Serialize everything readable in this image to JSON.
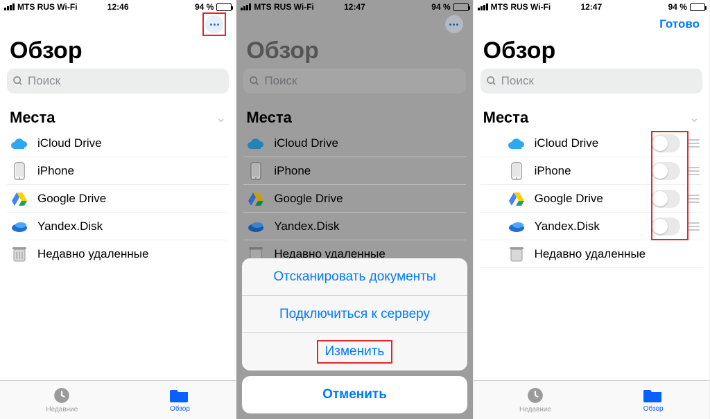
{
  "status": {
    "carrier": "MTS RUS Wi-Fi",
    "battery_pct": "94 %"
  },
  "screens": [
    {
      "time": "12:46",
      "title": "Обзор",
      "search_placeholder": "Поиск",
      "section": "Места",
      "nav_button": "more",
      "items": [
        {
          "icon": "icloud",
          "label": "iCloud Drive"
        },
        {
          "icon": "iphone",
          "label": "iPhone"
        },
        {
          "icon": "gdrive",
          "label": "Google Drive"
        },
        {
          "icon": "yadisk",
          "label": "Yandex.Disk"
        },
        {
          "icon": "trash",
          "label": "Недавно удаленные"
        }
      ],
      "highlight_more": true,
      "tabs": {
        "recent": "Недавние",
        "browse": "Обзор"
      }
    },
    {
      "time": "12:47",
      "title": "Обзор",
      "search_placeholder": "Поиск",
      "section": "Места",
      "nav_button": "more",
      "items": [
        {
          "icon": "icloud",
          "label": "iCloud Drive"
        },
        {
          "icon": "iphone",
          "label": "iPhone"
        },
        {
          "icon": "gdrive",
          "label": "Google Drive"
        },
        {
          "icon": "yadisk",
          "label": "Yandex.Disk"
        },
        {
          "icon": "trash",
          "label": "Недавно удаленные"
        }
      ],
      "action_sheet": {
        "options": [
          "Отсканировать документы",
          "Подключиться к серверу",
          "Изменить"
        ],
        "cancel": "Отменить",
        "highlight_index": 2
      }
    },
    {
      "time": "12:47",
      "title": "Обзор",
      "search_placeholder": "Поиск",
      "section": "Места",
      "nav_button": "done",
      "done_label": "Готово",
      "items": [
        {
          "icon": "icloud",
          "label": "iCloud Drive",
          "toggle": false,
          "handle": true
        },
        {
          "icon": "iphone",
          "label": "iPhone",
          "toggle": false,
          "handle": true
        },
        {
          "icon": "gdrive",
          "label": "Google Drive",
          "toggle": false,
          "handle": true
        },
        {
          "icon": "yadisk",
          "label": "Yandex.Disk",
          "toggle": false,
          "handle": true
        },
        {
          "icon": "trash",
          "label": "Недавно удаленные"
        }
      ],
      "toggles_highlight": true,
      "tabs": {
        "recent": "Недавние",
        "browse": "Обзор"
      }
    }
  ]
}
